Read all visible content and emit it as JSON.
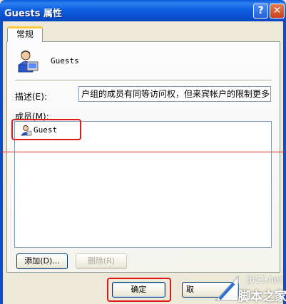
{
  "window": {
    "title": "Guests 属性",
    "help_label": "?",
    "close_label": "✕"
  },
  "tabs": [
    {
      "label": "常规"
    }
  ],
  "group": {
    "name": "Guests",
    "icon": "group-icon"
  },
  "description": {
    "label": "描述(E):",
    "value": "户组的成员有同等访问权，但来宾帐户的限制更多"
  },
  "members": {
    "label": "成员(M):",
    "items": [
      {
        "name": "Guest",
        "icon": "user-icon"
      }
    ]
  },
  "buttons": {
    "add": "添加(D)...",
    "remove": "删除(R)",
    "ok": "确定",
    "cancel_partial": "取"
  },
  "watermark": {
    "site": "jb51.net",
    "brand": "脚本之家"
  },
  "colors": {
    "titlebar": "#0a4fcf",
    "annotation_red": "#e01818",
    "dialog_bg": "#ece9d8"
  }
}
